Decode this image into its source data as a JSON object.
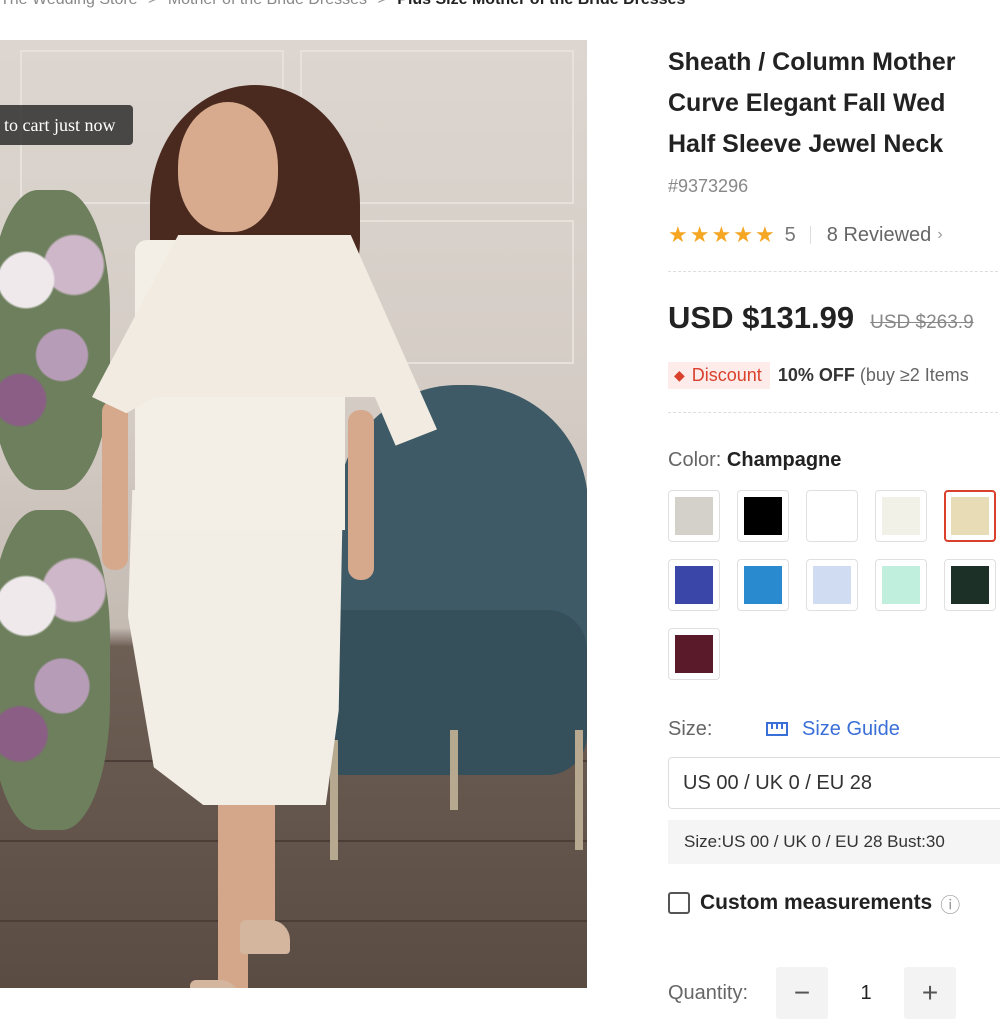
{
  "breadcrumb": {
    "items": [
      "The Wedding Store",
      "Mother of the Bride Dresses",
      "Plus Size Mother of the Bride Dresses"
    ],
    "separator": ">"
  },
  "image": {
    "cart_notice": "to cart just now"
  },
  "product": {
    "title": "Sheath / Column Mother\nCurve Elegant Fall Wed\nHalf Sleeve Jewel Neck",
    "sku": "#9373296",
    "rating_value": "5",
    "reviews": "8 Reviewed",
    "price": "USD $131.99",
    "old_price": "USD $263.9"
  },
  "discount": {
    "badge": "Discount",
    "bold": "10% OFF",
    "text": " (buy ≥2 Items"
  },
  "color": {
    "label": "Color: ",
    "selected": "Champagne",
    "swatches": [
      "#d3d1ca",
      "#000000",
      "#ffffff",
      "#f2f1e8",
      "#e8dcb6",
      "#3b47a8",
      "#2a8ad0",
      "#cfdcf1",
      "#c0f0dd",
      "#1c3028",
      "#5a1a2a"
    ]
  },
  "size": {
    "label": "Size:",
    "guide": "Size Guide",
    "selected": "US 00 / UK 0 / EU 28",
    "detail": "Size:US 00 / UK 0 / EU 28   Bust:30"
  },
  "custom": {
    "label": "Custom measurements"
  },
  "quantity": {
    "label": "Quantity:",
    "value": "1",
    "minus": "−",
    "plus": "+"
  }
}
